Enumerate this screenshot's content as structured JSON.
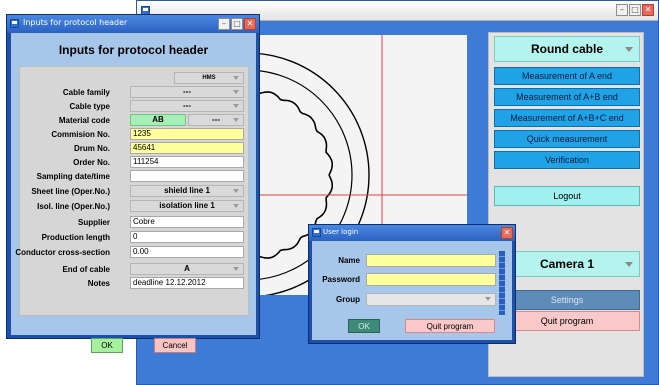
{
  "main_window": {
    "title": "",
    "product_select": "Round cable",
    "buttons": [
      "Measurement of A end",
      "Measurement of A+B end",
      "Measurement of A+B+C end",
      "Quick measurement",
      "Verification"
    ],
    "logout": "Logout",
    "camera_select": "Camera 1",
    "settings": "Settings",
    "quit": "Quit program"
  },
  "protocol_dialog": {
    "window_title": "Inputs for protocol header",
    "heading": "Inputs for protocol header",
    "top_select": "HMS",
    "fields": {
      "cable_family": {
        "label": "Cable family",
        "value": "---"
      },
      "cable_type": {
        "label": "Cable type",
        "value": "---"
      },
      "material_code": {
        "label": "Material code",
        "value": "AB",
        "value2": "---"
      },
      "commission_no": {
        "label": "Commision No.",
        "value": "1235"
      },
      "drum_no": {
        "label": "Drum No.",
        "value": "45641"
      },
      "order_no": {
        "label": "Order No.",
        "value": "111254"
      },
      "sampling": {
        "label": "Sampling date/time",
        "value": ""
      },
      "sheet_line": {
        "label": "Sheet line (Oper.No.)",
        "value": "shield line 1"
      },
      "isol_line": {
        "label": "Isol. line (Oper.No.)",
        "value": "isolation line 1"
      },
      "supplier": {
        "label": "Supplier",
        "value": "Cobre"
      },
      "production_length": {
        "label": "Production length",
        "value": "0"
      },
      "conductor_cross_section": {
        "label": "Conductor cross-section",
        "value": "0.00"
      },
      "end_of_cable": {
        "label": "End of cable",
        "value": "A"
      },
      "notes": {
        "label": "Notes",
        "value": "deadline 12.12.2012"
      }
    },
    "ok": "OK",
    "cancel": "Cancel"
  },
  "login_dialog": {
    "window_title": "User login",
    "name_label": "Name",
    "name_value": "",
    "password_label": "Password",
    "password_value": "",
    "group_label": "Group",
    "group_value": "",
    "ok": "OK",
    "quit": "Quit program"
  }
}
